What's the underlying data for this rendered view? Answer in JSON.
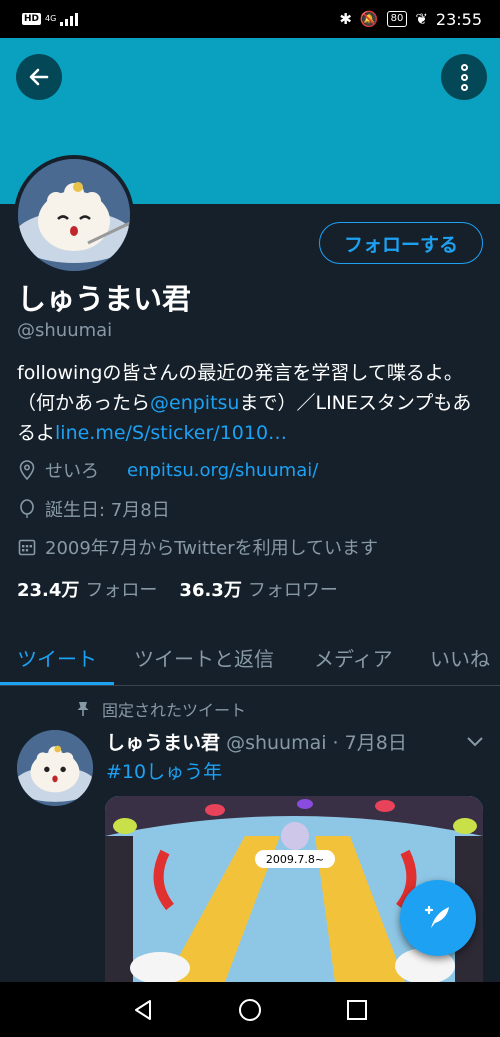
{
  "status_bar": {
    "network_hd": "HD",
    "network_4g": "4G",
    "battery": "80",
    "time": "23:55"
  },
  "profile": {
    "display_name": "しゅうまい君",
    "handle": "@shuumai",
    "follow_button": "フォローする",
    "bio": {
      "part1": "followingの皆さんの最近の発言を学習して喋るよ。（何かあったら",
      "mention": "@enpitsu",
      "part2": "まで）／LINEスタンプもあるよ",
      "link": "line.me/S/sticker/1010…"
    },
    "location": "せいろ",
    "website": "enpitsu.org/shuumai/",
    "birthday": "誕生日: 7月8日",
    "joined": "2009年7月からTwitterを利用しています",
    "following_count": "23.4万",
    "following_label": "フォロー",
    "followers_count": "36.3万",
    "followers_label": "フォロワー"
  },
  "tabs": [
    {
      "label": "ツイート",
      "active": true
    },
    {
      "label": "ツイートと返信",
      "active": false
    },
    {
      "label": "メディア",
      "active": false
    },
    {
      "label": "いいね",
      "active": false
    }
  ],
  "tweet": {
    "pinned_label": "固定されたツイート",
    "name": "しゅうまい君",
    "handle_time": "@shuumai · 7月8日",
    "text": "#10しゅう年",
    "image_caption": "2009.7.8~"
  },
  "colors": {
    "background": "#15202b",
    "banner": "#0aa1c0",
    "accent": "#1da1f2",
    "secondary_text": "#8899a6"
  },
  "icons": [
    "back-arrow-icon",
    "more-vert-icon",
    "location-pin-icon",
    "balloon-icon",
    "calendar-icon",
    "pin-icon",
    "chevron-down-icon",
    "compose-tweet-icon"
  ]
}
